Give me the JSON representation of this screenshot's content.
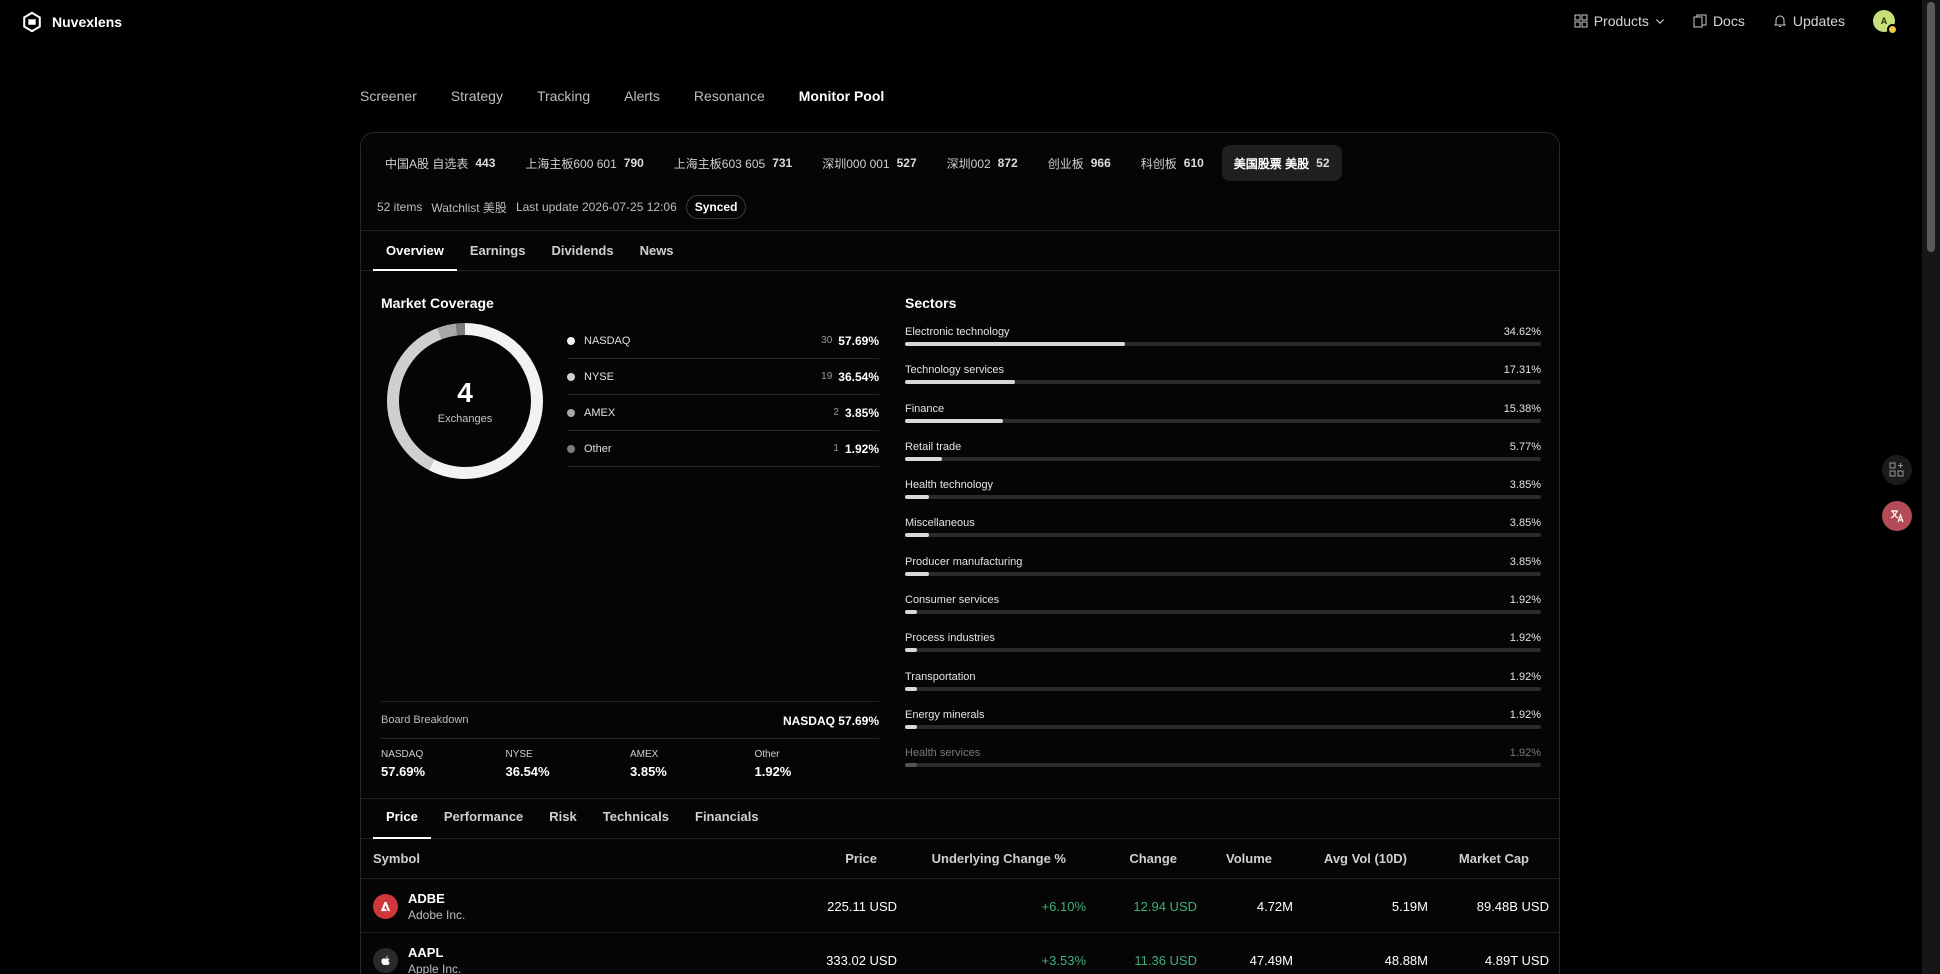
{
  "brand": {
    "name": "Nuvexlens"
  },
  "topnav": {
    "products": "Products",
    "docs": "Docs",
    "updates": "Updates",
    "avatar_initial": "A"
  },
  "mainnav": [
    "Screener",
    "Strategy",
    "Tracking",
    "Alerts",
    "Resonance",
    "Monitor Pool"
  ],
  "pool_tabs": [
    {
      "label": "中国A股 自选表",
      "count": "443"
    },
    {
      "label": "上海主板600 601",
      "count": "790"
    },
    {
      "label": "上海主板603 605",
      "count": "731"
    },
    {
      "label": "深圳000 001",
      "count": "527"
    },
    {
      "label": "深圳002",
      "count": "872"
    },
    {
      "label": "创业板",
      "count": "966"
    },
    {
      "label": "科创板",
      "count": "610"
    },
    {
      "label": "美国股票 美股",
      "count": "52"
    }
  ],
  "meta": {
    "items": "52 items",
    "watchlist": "Watchlist 美股",
    "last_update": "Last update 2026-07-25 12:06",
    "synced": "Synced"
  },
  "sub_tabs": [
    "Overview",
    "Earnings",
    "Dividends",
    "News"
  ],
  "coverage": {
    "title": "Market Coverage",
    "center_value": "4",
    "center_label": "Exchanges",
    "exchanges": [
      {
        "name": "NASDAQ",
        "count": "30",
        "pct": "57.69%",
        "value": 57.69,
        "color": "#f2f2f2"
      },
      {
        "name": "NYSE",
        "count": "19",
        "pct": "36.54%",
        "value": 36.54,
        "color": "#cfcfcf"
      },
      {
        "name": "AMEX",
        "count": "2",
        "pct": "3.85%",
        "value": 3.85,
        "color": "#a8a8a8"
      },
      {
        "name": "Other",
        "count": "1",
        "pct": "1.92%",
        "value": 1.92,
        "color": "#7d7d7d"
      }
    ],
    "board": {
      "title": "Board Breakdown",
      "lead": "NASDAQ 57.69%",
      "cells": [
        {
          "label": "NASDAQ",
          "value": "57.69%"
        },
        {
          "label": "NYSE",
          "value": "36.54%"
        },
        {
          "label": "AMEX",
          "value": "3.85%"
        },
        {
          "label": "Other",
          "value": "1.92%"
        }
      ]
    }
  },
  "sectors": {
    "title": "Sectors",
    "items": [
      {
        "name": "Electronic technology",
        "pct": "34.62%",
        "value": 34.62
      },
      {
        "name": "Technology services",
        "pct": "17.31%",
        "value": 17.31
      },
      {
        "name": "Finance",
        "pct": "15.38%",
        "value": 15.38
      },
      {
        "name": "Retail trade",
        "pct": "5.77%",
        "value": 5.77
      },
      {
        "name": "Health technology",
        "pct": "3.85%",
        "value": 3.85
      },
      {
        "name": "Miscellaneous",
        "pct": "3.85%",
        "value": 3.85
      },
      {
        "name": "Producer manufacturing",
        "pct": "3.85%",
        "value": 3.85
      },
      {
        "name": "Consumer services",
        "pct": "1.92%",
        "value": 1.92
      },
      {
        "name": "Process industries",
        "pct": "1.92%",
        "value": 1.92
      },
      {
        "name": "Transportation",
        "pct": "1.92%",
        "value": 1.92
      },
      {
        "name": "Energy minerals",
        "pct": "1.92%",
        "value": 1.92
      },
      {
        "name": "Health services",
        "pct": "1.92%",
        "value": 1.92
      }
    ]
  },
  "table_tabs": [
    "Price",
    "Performance",
    "Risk",
    "Technicals",
    "Financials"
  ],
  "table": {
    "columns": [
      "Symbol",
      "Price",
      "Underlying Change %",
      "Change",
      "Volume",
      "Avg Vol (10D)",
      "Market Cap"
    ],
    "rows": [
      {
        "ticker": "ADBE",
        "name": "Adobe Inc.",
        "price": "225.11 USD",
        "change_pct": "+6.10%",
        "change": "12.94 USD",
        "volume": "4.72M",
        "avg_vol": "5.19M",
        "market_cap": "89.48B USD",
        "logo_color": "#d0373c"
      },
      {
        "ticker": "AAPL",
        "name": "Apple Inc.",
        "price": "333.02 USD",
        "change_pct": "+3.53%",
        "change": "11.36 USD",
        "volume": "47.49M",
        "avg_vol": "48.88M",
        "market_cap": "4.89T USD",
        "logo_color": "#2a2a2a"
      }
    ]
  }
}
